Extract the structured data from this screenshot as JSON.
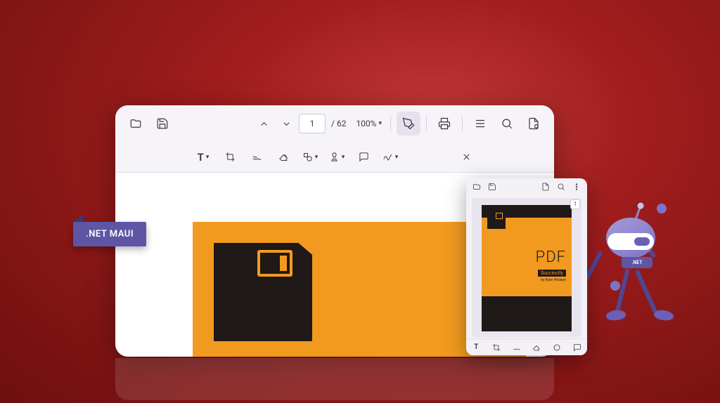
{
  "tag": {
    "label": ".NET MAUI"
  },
  "desktop": {
    "topToolbar": {
      "currentPage": "1",
      "totalPages": "/ 62",
      "zoom": "100%"
    }
  },
  "mobile": {
    "pageBadge": "1",
    "cover": {
      "title": "PDF",
      "subtitle": "Succinctly",
      "author": "by Ryan Hodson"
    }
  },
  "robot": {
    "belt": ".NET"
  }
}
